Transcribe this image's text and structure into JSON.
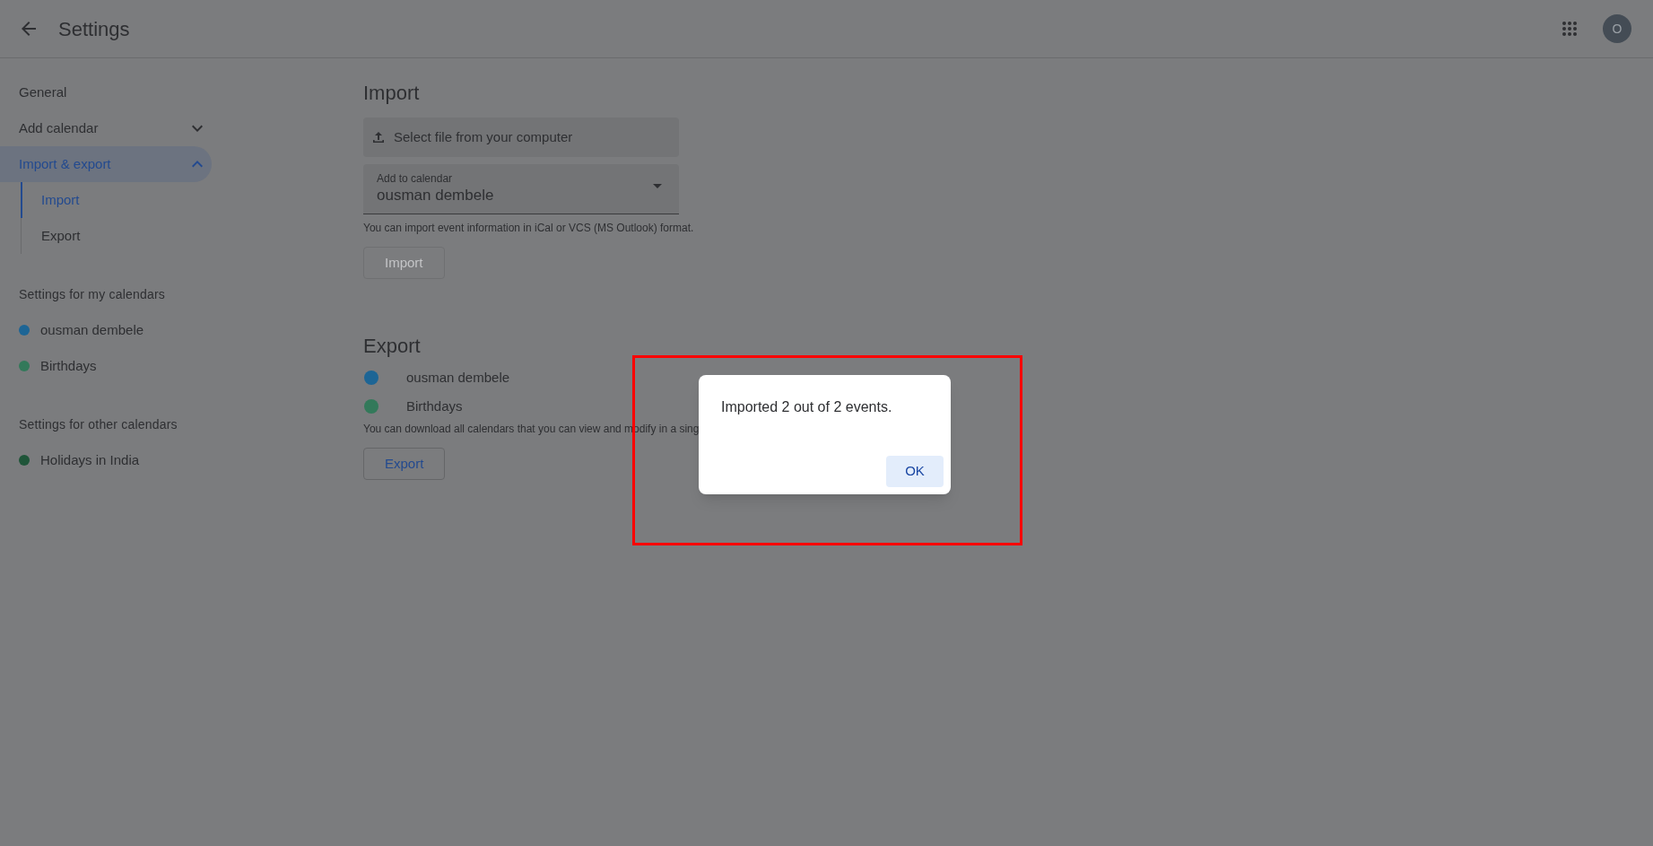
{
  "header": {
    "title": "Settings",
    "avatar": "O"
  },
  "sidebar": {
    "nav": [
      {
        "kind": "link",
        "label": "General",
        "selected": false
      },
      {
        "kind": "group",
        "label": "Add calendar",
        "selected": false,
        "expanded": false
      },
      {
        "kind": "group",
        "label": "Import & export",
        "selected": true,
        "expanded": true,
        "children": [
          {
            "label": "Import",
            "selected": true
          },
          {
            "label": "Export",
            "selected": false
          }
        ]
      }
    ],
    "sections": [
      {
        "title": "Settings for my calendars",
        "items": [
          {
            "label": "ousman dembele",
            "color": "#1d6595"
          },
          {
            "label": "Birthdays",
            "color": "#33795a"
          }
        ]
      },
      {
        "title": "Settings for other calendars",
        "items": [
          {
            "label": "Holidays in India",
            "color": "#1f5539"
          }
        ]
      }
    ]
  },
  "import": {
    "heading": "Import",
    "file_button": "Select file from your computer",
    "calendar_select": {
      "label": "Add to calendar",
      "value": "ousman dembele"
    },
    "hint": "You can import event information in iCal or VCS (MS Outlook) format.",
    "button": {
      "label": "Import",
      "disabled": true
    }
  },
  "export": {
    "heading": "Export",
    "calendars": [
      {
        "label": "ousman dembele",
        "color": "#1d6595"
      },
      {
        "label": "Birthdays",
        "color": "#33795a"
      }
    ],
    "hint": "You can download all calendars that you can view and modify in a sing",
    "button": {
      "label": "Export",
      "disabled": false
    }
  },
  "dialog": {
    "message": "Imported 2 out of 2 events.",
    "button": "OK"
  }
}
